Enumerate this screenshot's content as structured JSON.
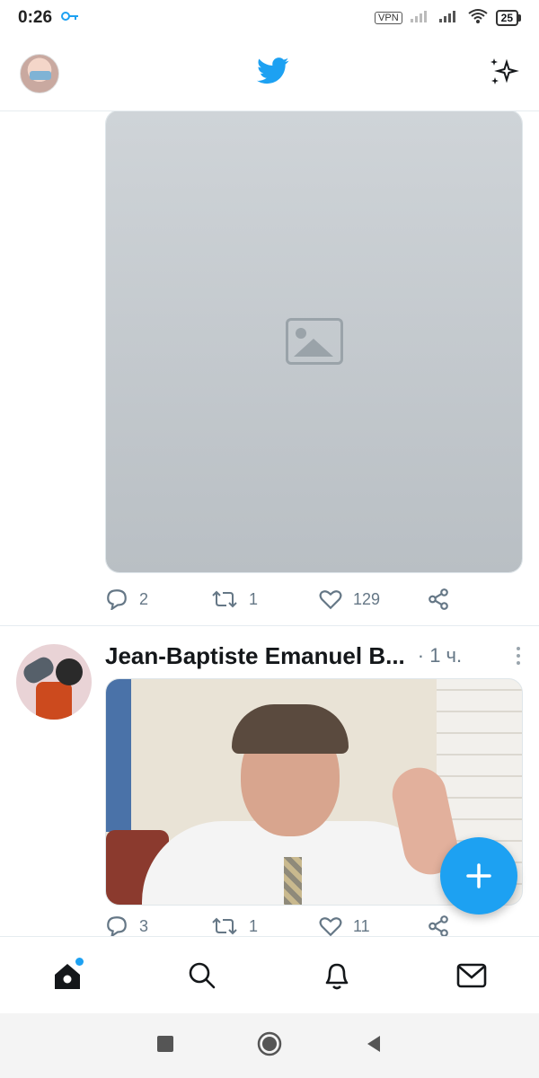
{
  "status_bar": {
    "time": "0:26",
    "vpn": "VPN",
    "battery": "25"
  },
  "header": {
    "logo_icon": "twitter-bird-icon",
    "sparkle_icon": "sparkle-icon"
  },
  "tweets": [
    {
      "media_kind": "photo",
      "actions": {
        "replies": "2",
        "retweets": "1",
        "likes": "129"
      }
    },
    {
      "author": "Jean-Baptiste Emanuel B...",
      "time": "· 1 ч.",
      "media_kind": "photo",
      "actions": {
        "replies": "3",
        "retweets": "1",
        "likes": "11"
      }
    }
  ],
  "bottom_nav": {
    "items": [
      "home-icon",
      "search-icon",
      "bell-icon",
      "mail-icon"
    ]
  },
  "colors": {
    "accent": "#1da1f2",
    "muted": "#657786",
    "divider": "#e6ecf0"
  }
}
